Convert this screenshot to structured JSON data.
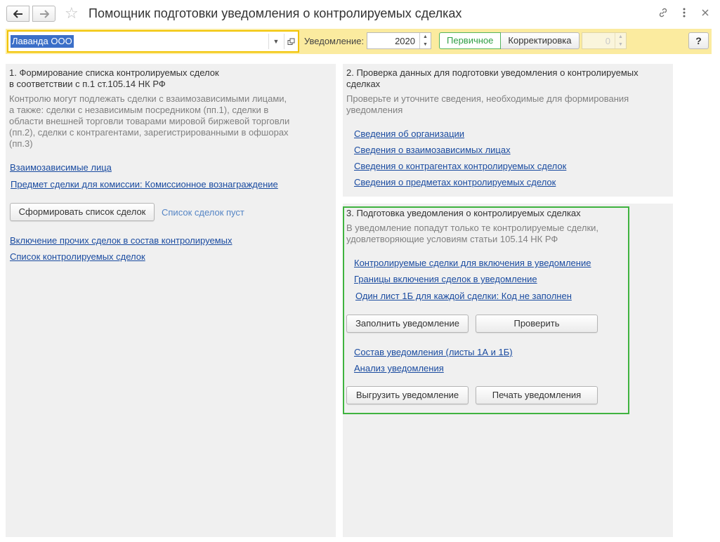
{
  "window": {
    "title": "Помощник подготовки уведомления о контролируемых сделках"
  },
  "icons": {
    "back": "arrow-left-icon",
    "forward": "arrow-right-icon",
    "favorite": "star-icon",
    "link": "link-icon",
    "more": "more-vertical-icon",
    "close": "close-icon"
  },
  "toolbar": {
    "organization_value": "Лаванда ООО",
    "notification_label": "Уведомление:",
    "year_value": "2020",
    "type_primary_label": "Первичное",
    "type_correction_label": "Корректировка",
    "correction_number_value": "0",
    "help_label": "?"
  },
  "section1": {
    "title_line1": "1. Формирование списка контролируемых сделок",
    "title_line2": "в соответствии с п.1 ст.105.14 НК РФ",
    "desc_lines": [
      "Контролю могут подлежать сделки с взаимозависимыми лицами,",
      "а также: сделки с независимым посредником (пп.1), сделки в",
      "области внешней торговли товарами мировой биржевой торговли",
      "(пп.2), сделки с контрагентами, зарегистрированными в офшорах",
      "(пп.3)"
    ],
    "link_related_parties": "Взаимозависимые лица",
    "link_commission_subject": "Предмет сделки для комиссии: Комиссионное вознаграждение",
    "form_list_button": "Сформировать список сделок",
    "list_status": "Список сделок пуст",
    "link_include_other": "Включение прочих сделок в состав контролируемых",
    "link_controlled_list": "Список контролируемых сделок"
  },
  "section2": {
    "title_line1": "2. Проверка данных для подготовки уведомления о контролируемых",
    "title_line2": "сделках",
    "desc_line1": "Проверьте и уточните сведения, необходимые для формирования",
    "desc_line2": "уведомления",
    "links": [
      "Сведения об организации",
      "Сведения о взаимозависимых лицах",
      "Сведения о контрагентах контролируемых сделок",
      "Сведения о предметах контролируемых сделок"
    ]
  },
  "section3": {
    "title": "3. Подготовка уведомления о контролируемых сделках",
    "desc_line1": "В уведомление попадут только те контролируемые сделки,",
    "desc_line2": "удовлетворяющие условиям статьи 105.14 НК РФ",
    "link_included_deals": "Контролируемые сделки для включения в уведомление",
    "link_boundaries": "Границы включения сделок в уведомление",
    "link_one_sheet": "Один лист 1Б для каждой сделки: Код не заполнен",
    "fill_button": "Заполнить уведомление",
    "check_button": "Проверить",
    "link_composition": "Состав уведомления (листы 1А и 1Б)",
    "link_analysis": "Анализ уведомления",
    "export_button": "Выгрузить уведомление",
    "print_button": "Печать уведомления"
  },
  "colors": {
    "toolbar_bg": "#fbeb9f",
    "panel_bg": "#f0f0f0",
    "link": "#1a4ba0",
    "highlight_border": "#3fb33f",
    "active_segment": "#2f9e44",
    "selection_bg": "#3b6fc8"
  }
}
